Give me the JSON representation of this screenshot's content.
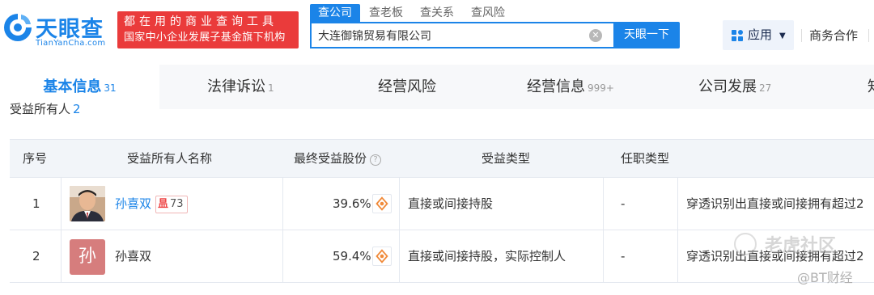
{
  "brand": {
    "name": "天眼查",
    "domain": "TianYanCha.com",
    "slogan_line1": "都在用的商业查询工具",
    "slogan_line2": "国家中小企业发展子基金旗下机构",
    "color": "#1b84e8"
  },
  "search": {
    "tabs": [
      "查公司",
      "查老板",
      "查关系",
      "查风险"
    ],
    "active_tab": "查公司",
    "query": "大连御锦贸易有限公司",
    "button_label": "天眼一下"
  },
  "header_right": {
    "apps_label": "应用",
    "business_label": "商务合作"
  },
  "nav": {
    "tabs": [
      {
        "label": "基本信息",
        "count": "31"
      },
      {
        "label": "法律诉讼",
        "count": "1"
      },
      {
        "label": "经营风险",
        "count": ""
      },
      {
        "label": "经营信息",
        "count": "999+"
      },
      {
        "label": "公司发展",
        "count": "27"
      },
      {
        "label": "知",
        "count": ""
      }
    ],
    "active": "基本信息"
  },
  "section": {
    "title": "受益所有人",
    "count": "2"
  },
  "table": {
    "headers": [
      "序号",
      "受益所有人名称",
      "最终受益股份",
      "受益类型",
      "任职类型",
      ""
    ],
    "rows": [
      {
        "index": "1",
        "name": "孙喜双",
        "avatar_type": "photo",
        "badge_count": "73",
        "share": "39.6%",
        "benefit_type": "直接或间接持股",
        "position": "-",
        "reason": "穿透识别出直接或间接拥有超过2"
      },
      {
        "index": "2",
        "name": "孙喜双",
        "avatar_type": "text",
        "avatar_char": "孙",
        "share": "59.4%",
        "benefit_type": "直接或间接持股，实际控制人",
        "position": "-",
        "reason": "穿透识别出直接或间接拥有超过2"
      }
    ]
  },
  "watermark": {
    "line1": "老虎社区",
    "line2": "@BT财经"
  }
}
